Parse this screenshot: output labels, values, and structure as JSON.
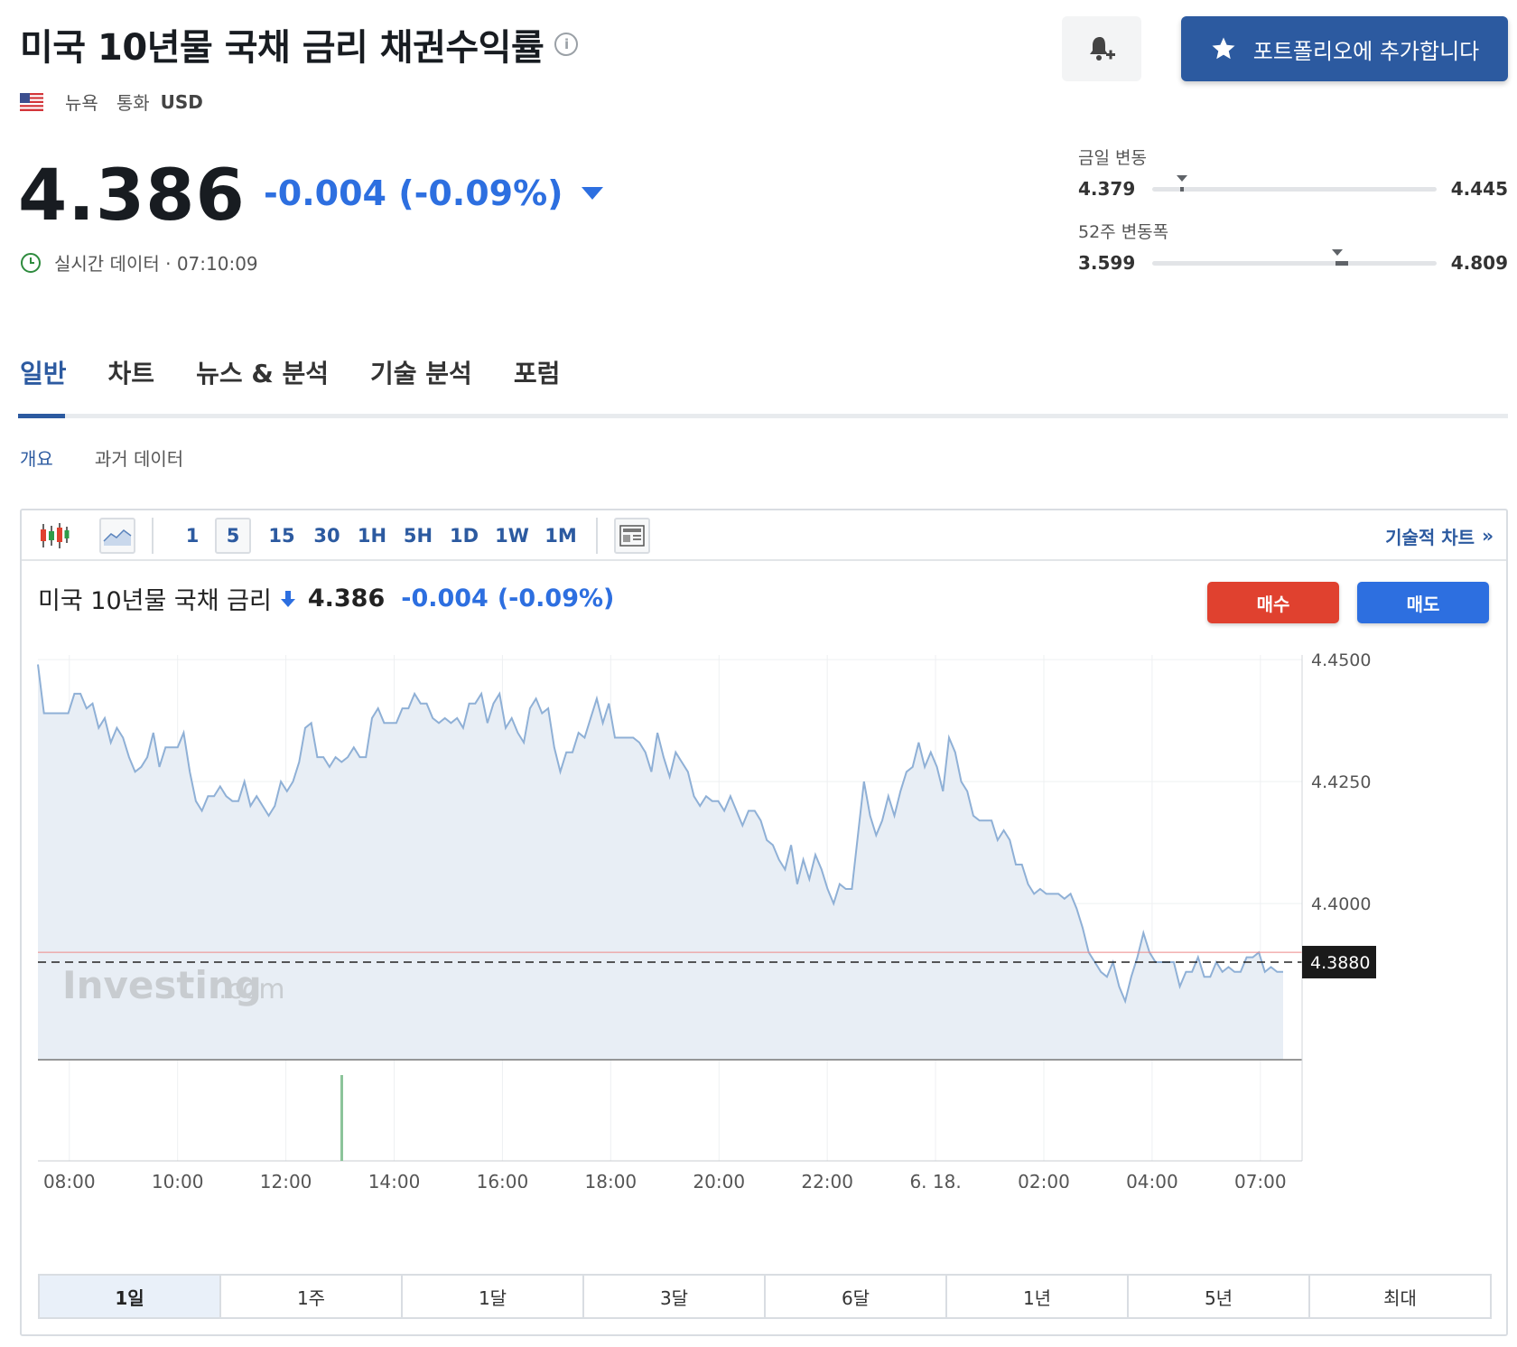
{
  "header": {
    "title": "미국 10년물 국채 금리 채권수익률",
    "info_icon": "info-icon",
    "exchange": "뉴욕",
    "currency_label": "통화",
    "currency": "USD",
    "portfolio_button": "포트폴리오에 추가합니다"
  },
  "quote": {
    "price": "4.386",
    "change": "-0.004 (-0.09%)",
    "realtime": "실시간 데이터 · 07:10:09"
  },
  "ranges": {
    "day": {
      "label": "금일 변동",
      "low": "4.379",
      "high": "4.445",
      "position": 0.106
    },
    "week52": {
      "label": "52주 변동폭",
      "low": "3.599",
      "high": "4.809",
      "position": 0.65
    }
  },
  "tabs": [
    "일반",
    "차트",
    "뉴스 & 분석",
    "기술 분석",
    "포럼"
  ],
  "subtabs": [
    "개요",
    "과거 데이터"
  ],
  "toolbar": {
    "intervals": [
      "1",
      "5",
      "15",
      "30",
      "1H",
      "5H",
      "1D",
      "1W",
      "1M"
    ],
    "selected_interval": "5",
    "tech_chart_link": "기술적 차트"
  },
  "chart_header": {
    "name": "미국 10년물 국채 금리",
    "price": "4.386",
    "change": "-0.004",
    "change_pct": "(-0.09%)",
    "buy": "매수",
    "sell": "매도"
  },
  "watermark": {
    "main": "Investing",
    "suffix": ".com"
  },
  "periods": [
    "1일",
    "1주",
    "1달",
    "3달",
    "6달",
    "1년",
    "5년",
    "최대"
  ],
  "selected_period": "1일",
  "colors": {
    "accent": "#2c5aa0",
    "down": "#2d6fe0",
    "buy": "#e0412f",
    "sell": "#2d6fe0",
    "line": "#8fb0d6",
    "area": "#e8eef5"
  },
  "chart_data": {
    "type": "area",
    "title": "",
    "xlabel": "",
    "ylabel": "",
    "ylim": [
      4.368,
      4.4565
    ],
    "yticks": [
      "4.4500",
      "4.4250",
      "4.4000"
    ],
    "ytick_values": [
      4.45,
      4.425,
      4.4
    ],
    "current_label": "4.3880",
    "current_value": 4.388,
    "reference_value": 4.39,
    "xtick_labels": [
      "08:00",
      "10:00",
      "12:00",
      "14:00",
      "16:00",
      "18:00",
      "20:00",
      "22:00",
      "6. 18.",
      "02:00",
      "04:00",
      "07:00"
    ],
    "xtick_hours": [
      1.0,
      3.0,
      5.0,
      7.0,
      9.0,
      11.0,
      13.0,
      15.0,
      17.0,
      19.0,
      21.0,
      23.0
    ],
    "x_start_hour": 0.42,
    "x_end_hour": 23.42,
    "values": [
      4.449,
      4.439,
      4.439,
      4.439,
      4.439,
      4.439,
      4.443,
      4.443,
      4.44,
      4.441,
      4.436,
      4.438,
      4.433,
      4.436,
      4.434,
      4.43,
      4.427,
      4.428,
      4.43,
      4.435,
      4.428,
      4.432,
      4.432,
      4.432,
      4.435,
      4.427,
      4.421,
      4.419,
      4.422,
      4.422,
      4.424,
      4.422,
      4.421,
      4.421,
      4.425,
      4.42,
      4.422,
      4.42,
      4.418,
      4.42,
      4.425,
      4.423,
      4.425,
      4.429,
      4.436,
      4.437,
      4.43,
      4.43,
      4.428,
      4.43,
      4.429,
      4.43,
      4.432,
      4.43,
      4.43,
      4.438,
      4.44,
      4.437,
      4.437,
      4.437,
      4.44,
      4.44,
      4.443,
      4.441,
      4.441,
      4.438,
      4.437,
      4.438,
      4.437,
      4.438,
      4.436,
      4.441,
      4.441,
      4.443,
      4.437,
      4.441,
      4.443,
      4.436,
      4.438,
      4.435,
      4.433,
      4.44,
      4.442,
      4.439,
      4.44,
      4.432,
      4.427,
      4.431,
      4.431,
      4.435,
      4.434,
      4.438,
      4.442,
      4.437,
      4.441,
      4.434,
      4.434,
      4.434,
      4.434,
      4.433,
      4.431,
      4.427,
      4.435,
      4.43,
      4.426,
      4.431,
      4.429,
      4.427,
      4.422,
      4.42,
      4.422,
      4.421,
      4.421,
      4.419,
      4.422,
      4.419,
      4.416,
      4.419,
      4.419,
      4.417,
      4.413,
      4.412,
      4.409,
      4.407,
      4.412,
      4.404,
      4.409,
      4.405,
      4.41,
      4.407,
      4.403,
      4.4,
      4.404,
      4.403,
      4.403,
      4.414,
      4.425,
      4.418,
      4.414,
      4.417,
      4.422,
      4.418,
      4.423,
      4.427,
      4.428,
      4.433,
      4.428,
      4.431,
      4.428,
      4.423,
      4.434,
      4.431,
      4.425,
      4.423,
      4.418,
      4.417,
      4.417,
      4.417,
      4.413,
      4.415,
      4.413,
      4.408,
      4.408,
      4.404,
      4.402,
      4.403,
      4.402,
      4.402,
      4.402,
      4.401,
      4.402,
      4.399,
      4.395,
      4.39,
      4.388,
      4.386,
      4.385,
      4.388,
      4.383,
      4.38,
      4.385,
      4.389,
      4.394,
      4.39,
      4.388,
      4.388,
      4.388,
      4.388,
      4.383,
      4.386,
      4.386,
      4.389,
      4.385,
      4.385,
      4.388,
      4.386,
      4.387,
      4.386,
      4.386,
      4.389,
      4.389,
      4.39,
      4.386,
      4.387,
      4.386,
      4.386
    ]
  }
}
